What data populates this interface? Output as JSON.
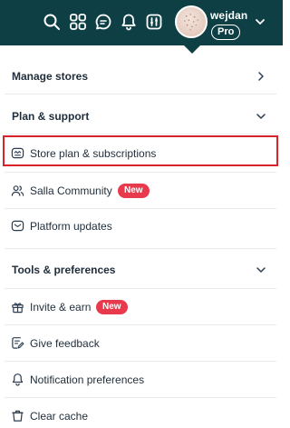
{
  "header": {
    "icons": [
      "search-icon",
      "grid-icon",
      "chat-icon",
      "bell-icon",
      "switch-icon"
    ],
    "username": "wejdan",
    "plan_badge": "Pro",
    "colors": {
      "bar": "#0e3f45",
      "badge_new": "#e8394d",
      "highlight": "#d8232a"
    }
  },
  "menu": {
    "manage_stores": "Manage stores",
    "plan_support": "Plan & support",
    "store_plan": "Store plan & subscriptions",
    "salla_community": "Salla Community",
    "community_badge": "New",
    "platform_updates": "Platform updates",
    "tools_preferences": "Tools & preferences",
    "invite_earn": "Invite & earn",
    "invite_badge": "New",
    "give_feedback": "Give feedback",
    "notification_preferences": "Notification preferences",
    "clear_cache": "Clear cache"
  }
}
